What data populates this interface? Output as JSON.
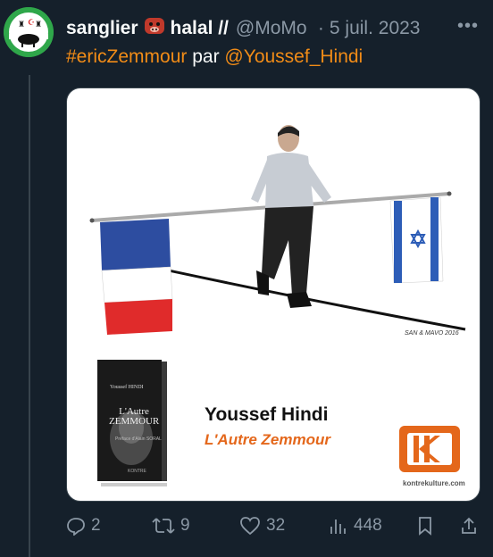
{
  "author": {
    "name": "sanglier",
    "name_suffix": "halal //",
    "handle": "@MoMo",
    "separator": "·",
    "date": "5 juil. 2023"
  },
  "tweet": {
    "hashtag": "#ericZemmour",
    "middle": "par",
    "mention": "@Youssef_Hindi"
  },
  "media": {
    "poster_author": "Youssef Hindi",
    "poster_book": "L'Autre Zemmour",
    "brand_url": "kontrekulture.com",
    "artist_signature": "SAN & MAVO 2016",
    "book_cover": {
      "author": "Youssef HINDI",
      "title_line1": "L'Autre",
      "title_line2": "ZEMMOUR",
      "subtitle": "Préface d'Alain SORAL",
      "publisher": "KONTRE"
    }
  },
  "actions": {
    "replies": "2",
    "retweets": "9",
    "likes": "32",
    "views": "448"
  },
  "colors": {
    "background": "#15202b",
    "accent": "#f28c17",
    "muted": "#8b98a5"
  }
}
